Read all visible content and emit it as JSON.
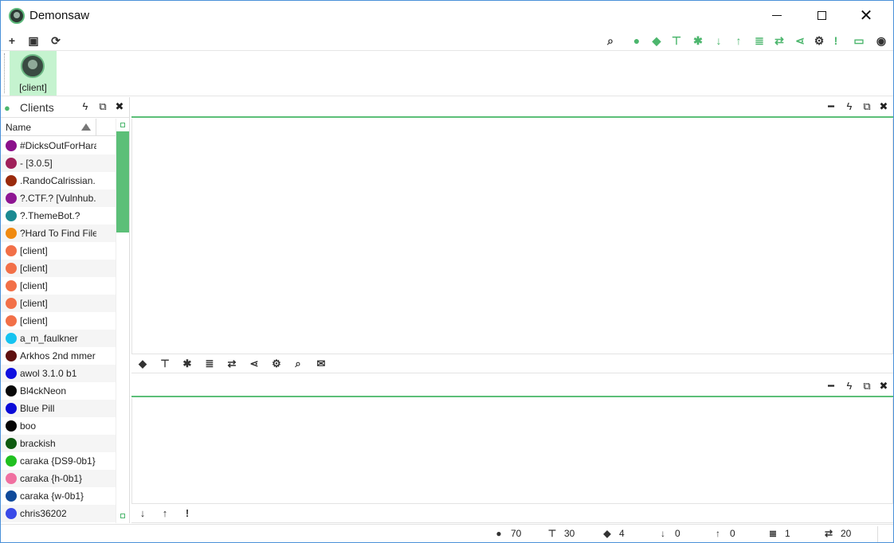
{
  "window": {
    "title": "Demonsaw",
    "minimize_icon": "minimize-icon",
    "maximize_icon": "maximize-icon",
    "close_glyph": "✕"
  },
  "toolbar": {
    "left": [
      {
        "icon": "plus-icon",
        "glyph": "+"
      },
      {
        "icon": "save-icon",
        "glyph": "▣"
      },
      {
        "icon": "refresh-icon",
        "glyph": "⟳"
      }
    ],
    "right": [
      {
        "icon": "search-icon",
        "glyph": "⌕",
        "style": "dark"
      },
      {
        "icon": "user-icon",
        "glyph": "●",
        "style": "green"
      },
      {
        "icon": "chat-icon",
        "glyph": "◆",
        "style": "green"
      },
      {
        "icon": "sitemap-icon",
        "glyph": "⊤",
        "style": "green"
      },
      {
        "icon": "group-icon",
        "glyph": "✱",
        "style": "green"
      },
      {
        "icon": "download-icon",
        "glyph": "↓",
        "style": "green"
      },
      {
        "icon": "upload-icon",
        "glyph": "↑",
        "style": "green"
      },
      {
        "icon": "list-icon",
        "glyph": "≣",
        "style": "green"
      },
      {
        "icon": "transfer-icon",
        "glyph": "⇄",
        "style": "green"
      },
      {
        "icon": "share-icon",
        "glyph": "⋖",
        "style": "green"
      },
      {
        "icon": "gear-icon",
        "glyph": "⚙",
        "style": "dark"
      },
      {
        "icon": "alert-icon",
        "glyph": "!",
        "style": "green"
      },
      {
        "icon": "monitor-icon",
        "glyph": "▭",
        "style": "green"
      },
      {
        "icon": "avatar-icon",
        "glyph": "◉",
        "style": "dark"
      }
    ]
  },
  "client_tab": {
    "label": "[client]"
  },
  "clients_panel": {
    "title": "Clients",
    "column_name": "Name",
    "clients": [
      {
        "name": "#DicksOutForHara",
        "color": "#8b108b"
      },
      {
        "name": "- [3.0.5]",
        "color": "#a0205a"
      },
      {
        "name": ".RandoCalrissian.",
        "color": "#9a2a0c"
      },
      {
        "name": "?.CTF.? [Vulnhub.c",
        "color": "#8e1592"
      },
      {
        "name": "?.ThemeBot.?",
        "color": "#1a8a92"
      },
      {
        "name": "?Hard To Find Files",
        "color": "#f08a10"
      },
      {
        "name": "[client]",
        "color": "#f27048"
      },
      {
        "name": "[client]",
        "color": "#f27048"
      },
      {
        "name": "[client]",
        "color": "#f27048"
      },
      {
        "name": "[client]",
        "color": "#f27048"
      },
      {
        "name": "[client]",
        "color": "#f27048"
      },
      {
        "name": "a_m_faulkner",
        "color": "#16c3f0"
      },
      {
        "name": "Arkhos 2nd mmer",
        "color": "#5e1010"
      },
      {
        "name": "awol 3.1.0 b1",
        "color": "#1010e0"
      },
      {
        "name": "Bl4ckNeon",
        "color": "#080808"
      },
      {
        "name": "Blue Pill",
        "color": "#0a0ad8"
      },
      {
        "name": "boo",
        "color": "#050505"
      },
      {
        "name": "brackish",
        "color": "#0e5a10"
      },
      {
        "name": "caraka {DS9-0b1}",
        "color": "#20c020"
      },
      {
        "name": "caraka {h-0b1}",
        "color": "#f070a0"
      },
      {
        "name": "caraka {w-0b1}",
        "color": "#104a9a"
      },
      {
        "name": "chris36202",
        "color": "#3a4ae8"
      }
    ]
  },
  "pane_controls": {
    "minimize": "━",
    "bolt": "ϟ",
    "restore": "⧉",
    "close": "✖"
  },
  "upper_pane_tools": [
    {
      "icon": "chat-icon",
      "glyph": "◆"
    },
    {
      "icon": "sitemap-icon",
      "glyph": "⊤"
    },
    {
      "icon": "group-icon",
      "glyph": "✱"
    },
    {
      "icon": "list-icon",
      "glyph": "≣"
    },
    {
      "icon": "transfer-icon",
      "glyph": "⇄"
    },
    {
      "icon": "share-icon",
      "glyph": "⋖"
    },
    {
      "icon": "gear-icon",
      "glyph": "⚙"
    },
    {
      "icon": "search-icon",
      "glyph": "⌕"
    },
    {
      "icon": "mail-icon",
      "glyph": "✉"
    }
  ],
  "lower_pane_tools": [
    {
      "icon": "download-icon",
      "glyph": "↓"
    },
    {
      "icon": "upload-icon",
      "glyph": "↑"
    },
    {
      "icon": "alert-icon",
      "glyph": "!"
    }
  ],
  "status": [
    {
      "icon": "user-icon",
      "glyph": "●",
      "value": "70"
    },
    {
      "icon": "sitemap-icon",
      "glyph": "⊤",
      "value": "30"
    },
    {
      "icon": "chat-icon",
      "glyph": "◆",
      "value": "4"
    },
    {
      "icon": "download-icon",
      "glyph": "↓",
      "value": "0"
    },
    {
      "icon": "upload-icon",
      "glyph": "↑",
      "value": "0"
    },
    {
      "icon": "list-icon",
      "glyph": "≣",
      "value": "1"
    },
    {
      "icon": "transfer-icon",
      "glyph": "⇄",
      "value": "20"
    }
  ]
}
